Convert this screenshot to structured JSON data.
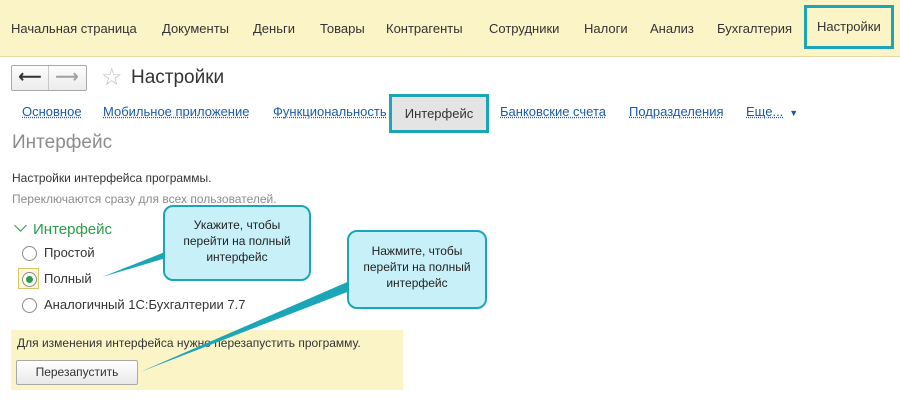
{
  "top_menu": [
    {
      "id": "home",
      "label": "Начальная страница"
    },
    {
      "id": "documents",
      "label": "Документы"
    },
    {
      "id": "money",
      "label": "Деньги"
    },
    {
      "id": "goods",
      "label": "Товары"
    },
    {
      "id": "counterparties",
      "label": "Контрагенты"
    },
    {
      "id": "employees",
      "label": "Сотрудники"
    },
    {
      "id": "taxes",
      "label": "Налоги"
    },
    {
      "id": "analysis",
      "label": "Анализ"
    },
    {
      "id": "accounting",
      "label": "Бухгалтерия"
    },
    {
      "id": "settings",
      "label": "Настройки",
      "active": true
    }
  ],
  "nav": {
    "back_glyph": "⟵",
    "forward_glyph": "⟶",
    "star_glyph": "☆"
  },
  "page_title": "Настройки",
  "tabs": [
    {
      "label": "Основное"
    },
    {
      "label": "Мобильное приложение"
    },
    {
      "label": "Функциональность"
    },
    {
      "label": "Интерфейс",
      "active": true
    },
    {
      "label": "Банковские счета"
    },
    {
      "label": "Подразделения"
    },
    {
      "label": "Еще..."
    }
  ],
  "section": {
    "title": "Интерфейс",
    "desc": "Настройки интерфейса программы.",
    "desc_note": "Переключаются сразу для всех пользователей."
  },
  "group": {
    "title": "Интерфейс",
    "options": [
      {
        "label": "Простой",
        "checked": false
      },
      {
        "label": "Полный",
        "checked": true
      },
      {
        "label": "Аналогичный 1С:Бухгалтерии 7.7",
        "checked": false
      }
    ]
  },
  "notice": {
    "text": "Для изменения интерфейса нужно перезапустить программу.",
    "button": "Перезапустить"
  },
  "callouts": {
    "first": "Укажите, чтобы перейти на полный интерфейс",
    "second": "Нажмите, чтобы перейти на полный интерфейс"
  },
  "colors": {
    "accent": "#1aa6b7",
    "menu_bg": "#fbf4c7",
    "link": "#1a5ba8",
    "green": "#2a9d47",
    "callout_bg": "#c8f0f8"
  }
}
